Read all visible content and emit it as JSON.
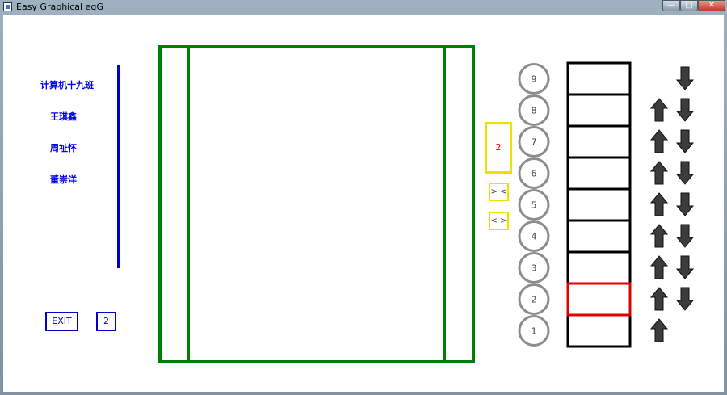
{
  "window": {
    "title": "Easy Graphical egG",
    "min_symbol": "—",
    "max_symbol": "□",
    "close_symbol": "✕"
  },
  "sidebar": {
    "names": [
      "计算机十九班",
      "王琪鑫",
      "周祉怀",
      "董崇洋"
    ],
    "exit_label": "EXIT",
    "current_floor": "2"
  },
  "controls": {
    "display_value": "2",
    "close_door_label": "> <",
    "open_door_label": "< >"
  },
  "floors": [
    "9",
    "8",
    "7",
    "6",
    "5",
    "4",
    "3",
    "2",
    "1"
  ],
  "active_floor": "2",
  "up_floors": [
    "8",
    "7",
    "6",
    "5",
    "4",
    "3",
    "2",
    "1"
  ],
  "down_floors": [
    "9",
    "8",
    "7",
    "6",
    "5",
    "4",
    "3",
    "2"
  ],
  "colors": {
    "shaft": "#008000",
    "sidebar_text": "#0000ee",
    "divider": "#0000cc",
    "highlight": "#e00000",
    "button_border": "#f0e000",
    "floor_circle": "#8c8c8c",
    "shaft_cells": "#000000"
  },
  "icons": {
    "up": "arrow-up-icon",
    "down": "arrow-down-icon"
  }
}
